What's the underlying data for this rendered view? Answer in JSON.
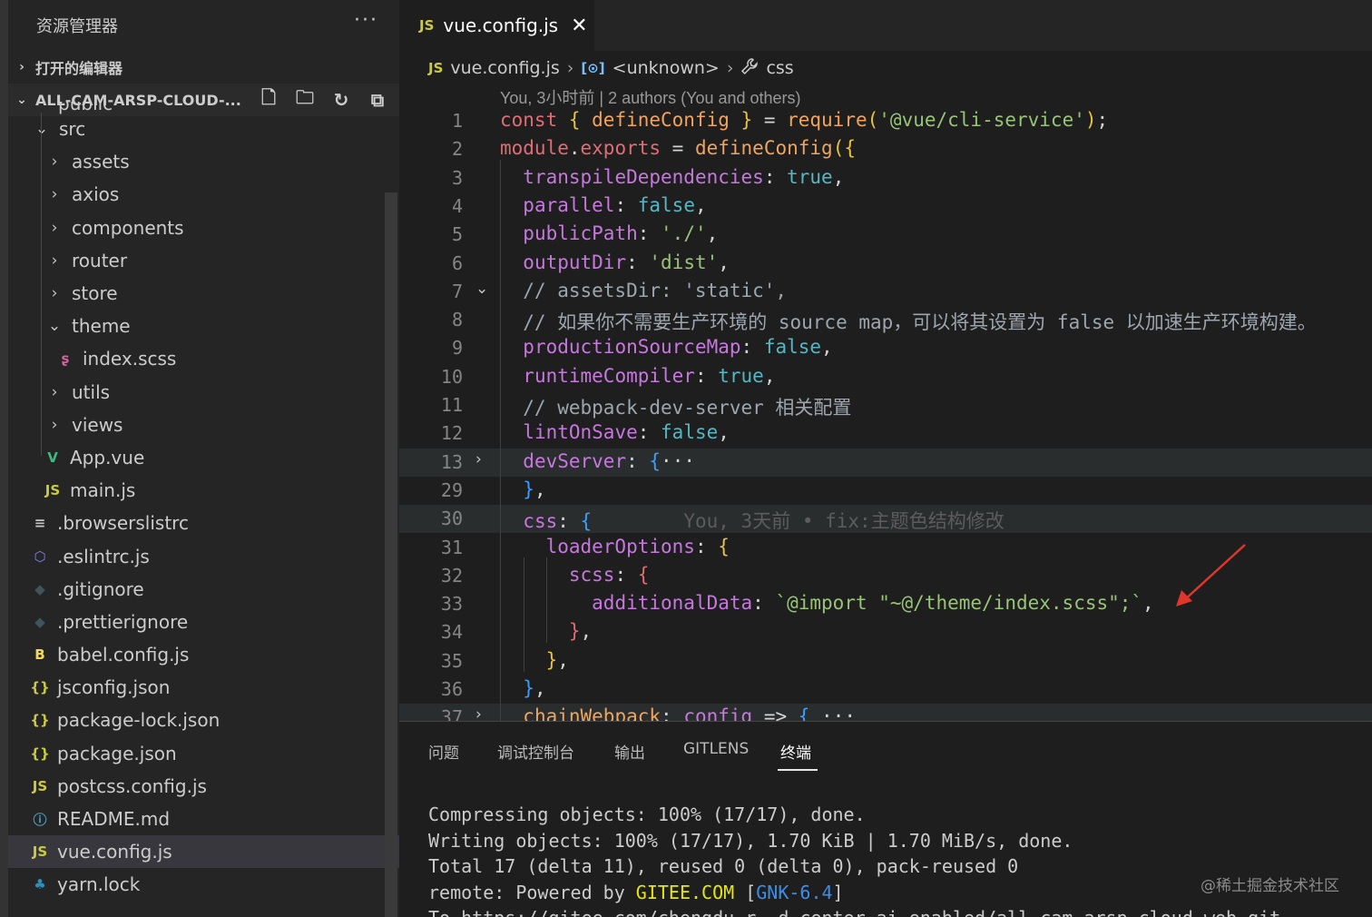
{
  "sidebar": {
    "title": "资源管理器",
    "more": "···",
    "open_editors": "打开的编辑器",
    "project": "ALL-CAM-ARSP-CLOUD-...",
    "partial_row": "public",
    "tree": [
      {
        "label": "src",
        "twisty": "⌄",
        "icon": "",
        "indent": 0
      },
      {
        "label": "assets",
        "twisty": "›",
        "icon": "",
        "indent": 1
      },
      {
        "label": "axios",
        "twisty": "›",
        "icon": "",
        "indent": 1
      },
      {
        "label": "components",
        "twisty": "›",
        "icon": "",
        "indent": 1
      },
      {
        "label": "router",
        "twisty": "›",
        "icon": "",
        "indent": 1
      },
      {
        "label": "store",
        "twisty": "›",
        "icon": "",
        "indent": 1
      },
      {
        "label": "theme",
        "twisty": "⌄",
        "icon": "",
        "indent": 1
      },
      {
        "label": "index.scss",
        "twisty": "",
        "icon": "sass-icon",
        "indent": 2
      },
      {
        "label": "utils",
        "twisty": "›",
        "icon": "",
        "indent": 1
      },
      {
        "label": "views",
        "twisty": "›",
        "icon": "",
        "indent": 1
      },
      {
        "label": "App.vue",
        "twisty": "",
        "icon": "vue-icon",
        "indent": 1
      },
      {
        "label": "main.js",
        "twisty": "",
        "icon": "js-icon",
        "indent": 1
      },
      {
        "label": ".browserslistrc",
        "twisty": "",
        "icon": "lines-icon",
        "indent": 0
      },
      {
        "label": ".eslintrc.js",
        "twisty": "",
        "icon": "eslint-icon",
        "indent": 0
      },
      {
        "label": ".gitignore",
        "twisty": "",
        "icon": "git-icon",
        "indent": 0
      },
      {
        "label": ".prettierignore",
        "twisty": "",
        "icon": "prettier-icon",
        "indent": 0
      },
      {
        "label": "babel.config.js",
        "twisty": "",
        "icon": "babel-icon",
        "indent": 0
      },
      {
        "label": "jsconfig.json",
        "twisty": "",
        "icon": "json-icon",
        "indent": 0
      },
      {
        "label": "package-lock.json",
        "twisty": "",
        "icon": "json-icon",
        "indent": 0
      },
      {
        "label": "package.json",
        "twisty": "",
        "icon": "json-icon",
        "indent": 0
      },
      {
        "label": "postcss.config.js",
        "twisty": "",
        "icon": "js-icon",
        "indent": 0
      },
      {
        "label": "README.md",
        "twisty": "",
        "icon": "info-icon",
        "indent": 0
      },
      {
        "label": "vue.config.js",
        "twisty": "",
        "icon": "js-icon",
        "indent": 0,
        "active": true
      },
      {
        "label": "yarn.lock",
        "twisty": "",
        "icon": "yarn-icon",
        "indent": 0
      }
    ]
  },
  "tab": {
    "badge": "JS",
    "label": "vue.config.js",
    "close": "✕"
  },
  "breadcrumb": {
    "badge": "JS",
    "file": "vue.config.js",
    "sym_badge": "[⊙]",
    "symbol": "<unknown>",
    "prop": "css"
  },
  "editor": {
    "codelens": "You, 3小时前 | 2 authors (You and others)",
    "lines": [
      {
        "n": "1",
        "fold": "",
        "parts": [
          [
            "k",
            "const "
          ],
          [
            "p",
            "{ "
          ],
          [
            "fn",
            "defineConfig"
          ],
          [
            "p",
            " }"
          ],
          [
            "br",
            " = "
          ],
          [
            "fn",
            "require"
          ],
          [
            "p",
            "("
          ],
          [
            "s",
            "'@vue/cli-service'"
          ],
          [
            "p",
            ")"
          ],
          [
            "br",
            ";"
          ]
        ]
      },
      {
        "n": "2",
        "fold": "",
        "parts": [
          [
            "k",
            "module"
          ],
          [
            "br",
            "."
          ],
          [
            "k",
            "exports"
          ],
          [
            "br",
            " = "
          ],
          [
            "fn",
            "defineConfig"
          ],
          [
            "p",
            "({"
          ]
        ]
      },
      {
        "n": "3",
        "fold": "",
        "parts": [
          [
            "br",
            "  "
          ],
          [
            "pr",
            "transpileDependencies"
          ],
          [
            "br",
            ": "
          ],
          [
            "bo",
            "true"
          ],
          [
            "br",
            ","
          ]
        ]
      },
      {
        "n": "4",
        "fold": "",
        "parts": [
          [
            "br",
            "  "
          ],
          [
            "pr",
            "parallel"
          ],
          [
            "br",
            ": "
          ],
          [
            "bo",
            "false"
          ],
          [
            "br",
            ","
          ]
        ]
      },
      {
        "n": "5",
        "fold": "",
        "parts": [
          [
            "br",
            "  "
          ],
          [
            "pr",
            "publicPath"
          ],
          [
            "br",
            ": "
          ],
          [
            "s",
            "'./'"
          ],
          [
            "br",
            ","
          ]
        ]
      },
      {
        "n": "6",
        "fold": "",
        "parts": [
          [
            "br",
            "  "
          ],
          [
            "pr",
            "outputDir"
          ],
          [
            "br",
            ": "
          ],
          [
            "s",
            "'dist'"
          ],
          [
            "br",
            ","
          ]
        ]
      },
      {
        "n": "7",
        "fold": "⌄",
        "parts": [
          [
            "cm",
            "  // assetsDir: 'static',"
          ]
        ]
      },
      {
        "n": "8",
        "fold": "",
        "parts": [
          [
            "cm",
            "  // 如果你不需要生产环境的 source map，可以将其设置为 false 以加速生产环境构建。"
          ]
        ]
      },
      {
        "n": "9",
        "fold": "",
        "parts": [
          [
            "br",
            "  "
          ],
          [
            "pr",
            "productionSourceMap"
          ],
          [
            "br",
            ": "
          ],
          [
            "bo",
            "false"
          ],
          [
            "br",
            ","
          ]
        ]
      },
      {
        "n": "10",
        "fold": "",
        "parts": [
          [
            "br",
            "  "
          ],
          [
            "pr",
            "runtimeCompiler"
          ],
          [
            "br",
            ": "
          ],
          [
            "bo",
            "true"
          ],
          [
            "br",
            ","
          ]
        ]
      },
      {
        "n": "11",
        "fold": "",
        "parts": [
          [
            "cm",
            "  // webpack-dev-server 相关配置"
          ]
        ]
      },
      {
        "n": "12",
        "fold": "",
        "parts": [
          [
            "br",
            "  "
          ],
          [
            "pr",
            "lintOnSave"
          ],
          [
            "br",
            ": "
          ],
          [
            "bo",
            "false"
          ],
          [
            "br",
            ","
          ]
        ]
      },
      {
        "n": "13",
        "fold": "›",
        "hl": true,
        "parts": [
          [
            "br",
            "  "
          ],
          [
            "pr",
            "devServer"
          ],
          [
            "br",
            ": "
          ],
          [
            "b",
            "{"
          ],
          [
            "br",
            "···"
          ]
        ]
      },
      {
        "n": "29",
        "fold": "",
        "parts": [
          [
            "br",
            "  "
          ],
          [
            "b",
            "}"
          ],
          [
            "br",
            ","
          ]
        ]
      },
      {
        "n": "30",
        "fold": "",
        "hl": true,
        "parts": [
          [
            "br",
            "  "
          ],
          [
            "pr",
            "css"
          ],
          [
            "br",
            ": "
          ],
          [
            "b",
            "{"
          ],
          [
            "blame",
            "        You, 3天前 • fix:主题色结构修改"
          ]
        ]
      },
      {
        "n": "31",
        "fold": "",
        "parts": [
          [
            "br",
            "    "
          ],
          [
            "pr",
            "loaderOptions"
          ],
          [
            "br",
            ": "
          ],
          [
            "p",
            "{"
          ]
        ]
      },
      {
        "n": "32",
        "fold": "",
        "parts": [
          [
            "br",
            "      "
          ],
          [
            "pr",
            "scss"
          ],
          [
            "br",
            ": "
          ],
          [
            "k",
            "{"
          ]
        ]
      },
      {
        "n": "33",
        "fold": "",
        "parts": [
          [
            "br",
            "        "
          ],
          [
            "pr",
            "additionalData"
          ],
          [
            "br",
            ": "
          ],
          [
            "s",
            "`@import \"~@/theme/index.scss\";`"
          ],
          [
            "br",
            ","
          ]
        ]
      },
      {
        "n": "34",
        "fold": "",
        "parts": [
          [
            "br",
            "      "
          ],
          [
            "k",
            "}"
          ],
          [
            "br",
            ","
          ]
        ]
      },
      {
        "n": "35",
        "fold": "",
        "parts": [
          [
            "br",
            "    "
          ],
          [
            "p",
            "}"
          ],
          [
            "br",
            ","
          ]
        ]
      },
      {
        "n": "36",
        "fold": "",
        "parts": [
          [
            "br",
            "  "
          ],
          [
            "b",
            "}"
          ],
          [
            "br",
            ","
          ]
        ]
      },
      {
        "n": "37",
        "fold": "›",
        "hl": true,
        "parts": [
          [
            "br",
            "  "
          ],
          [
            "fn",
            "chainWebpack"
          ],
          [
            "br",
            ": "
          ],
          [
            "pr",
            "config"
          ],
          [
            "br",
            " => "
          ],
          [
            "b",
            "{"
          ],
          [
            "br",
            " ···"
          ]
        ]
      }
    ]
  },
  "panel": {
    "tabs": [
      "问题",
      "调试控制台",
      "输出",
      "GITLENS",
      "终端"
    ],
    "terminal": [
      "Compressing objects: 100% (17/17), done.",
      "Writing objects: 100% (17/17), 1.70 KiB | 1.70 MiB/s, done.",
      "Total 17 (delta 11), reused 0 (delta 0), pack-reused 0"
    ],
    "remote_prefix": "remote: Powered by ",
    "remote_gitee": "GITEE.COM",
    "remote_bracket_open": " [",
    "remote_gnk": "GNK-6.4",
    "remote_bracket_close": "]",
    "last_line": "To https://gitee.com/chengdu-r--d-center-ai-enabled/all-cam-arsp-cloud-web.git",
    "watermark": "@稀土掘金技术社区"
  },
  "colors": {
    "accent": "#cbcb41",
    "arrow": "#e0352b",
    "vue": "#41b883",
    "sass": "#cd6799"
  }
}
